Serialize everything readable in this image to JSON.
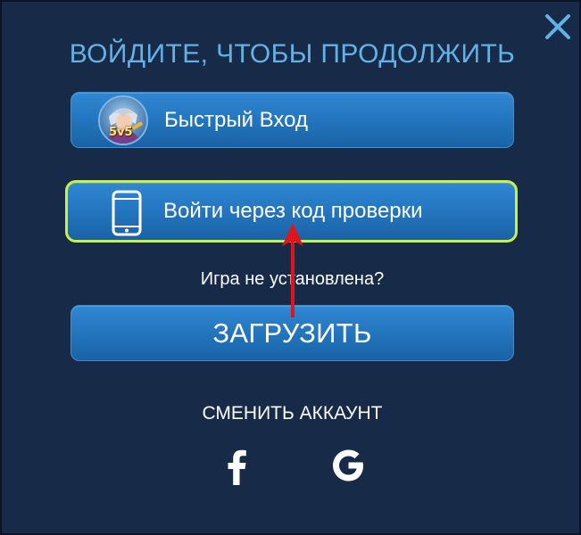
{
  "dialog": {
    "title": "ВОЙДИТЕ, ЧТОБЫ ПРОДОЛЖИТЬ",
    "close_icon": "close-icon"
  },
  "quick_login": {
    "label": "Быстрый Вход",
    "avatar_badge": "5v5",
    "icon": "game-avatar"
  },
  "verify_login": {
    "label": "Войти через код проверки",
    "icon": "phone-icon",
    "highlight_color": "#c9f23e"
  },
  "install": {
    "prompt": "Игра не установлена?",
    "download_label": "ЗАГРУЗИТЬ"
  },
  "switch_account": {
    "label": "СМЕНИТЬ АККАУНТ",
    "providers": [
      "facebook-icon",
      "google-icon"
    ]
  },
  "colors": {
    "background": "#172a48",
    "title": "#63b1e6",
    "button": "#2375be",
    "annotation_arrow": "#e0141c"
  }
}
